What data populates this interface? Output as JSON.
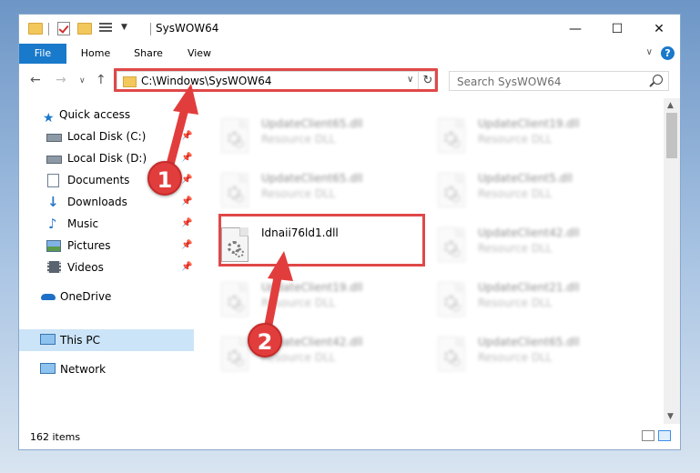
{
  "window": {
    "title": "SysWOW64"
  },
  "ribbon": {
    "tabs": [
      "File",
      "Home",
      "Share",
      "View"
    ]
  },
  "nav": {
    "address": "C:\\Windows\\SysWOW64",
    "search_placeholder": "Search SysWOW64"
  },
  "sidebar": {
    "items": [
      {
        "label": "Quick access",
        "icon": "star-icon"
      },
      {
        "label": "Local Disk (C:)",
        "icon": "drive-icon",
        "pinned": true
      },
      {
        "label": "Local Disk (D:)",
        "icon": "drive-icon",
        "pinned": true
      },
      {
        "label": "Documents",
        "icon": "documents-icon",
        "pinned": true
      },
      {
        "label": "Downloads",
        "icon": "download-arrow-icon",
        "pinned": true
      },
      {
        "label": "Music",
        "icon": "music-note-icon",
        "pinned": true
      },
      {
        "label": "Pictures",
        "icon": "pictures-icon",
        "pinned": true
      },
      {
        "label": "Videos",
        "icon": "film-icon",
        "pinned": true
      },
      {
        "label": "OneDrive",
        "icon": "cloud-icon"
      },
      {
        "label": "This PC",
        "icon": "computer-icon",
        "selected": true
      },
      {
        "label": "Network",
        "icon": "network-icon"
      }
    ]
  },
  "files": [
    {
      "name": "UpdateClient65.dll",
      "type": "Resource DLL"
    },
    {
      "name": "UpdateClient19.dll",
      "type": "Resource DLL"
    },
    {
      "name": "UpdateClient65.dll",
      "type": "Resource DLL"
    },
    {
      "name": "UpdateClient5.dll",
      "type": "Resource DLL"
    },
    {
      "name": "Idnaii76ld1.dll",
      "type": ""
    },
    {
      "name": "UpdateClient42.dll",
      "type": "Resource DLL"
    },
    {
      "name": "UpdateClient19.dll",
      "type": "Resource DLL"
    },
    {
      "name": "UpdateClient21.dll",
      "type": "Resource DLL"
    },
    {
      "name": "UpdateClient42.dll",
      "type": "Resource DLL"
    },
    {
      "name": "UpdateClient65.dll",
      "type": "Resource DLL"
    }
  ],
  "status": {
    "item_count": "162 items"
  },
  "callouts": [
    "1",
    "2"
  ],
  "colors": {
    "accent": "#1979ca",
    "highlight": "#e04848",
    "selected": "#cce4f7"
  }
}
